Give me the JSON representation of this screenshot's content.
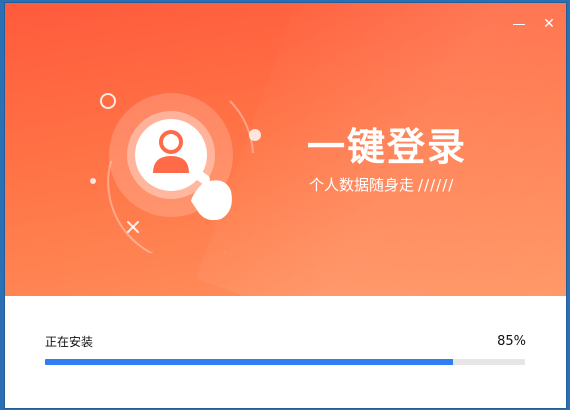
{
  "window": {
    "controls": {
      "minimize_icon": "minimize-icon",
      "close_icon": "close-icon",
      "close_glyph": "✕"
    }
  },
  "banner": {
    "title": "一键登录",
    "subtitle": "个人数据随身走",
    "slashes": "//////",
    "colors": {
      "gradient_start": "#ff5a3c",
      "gradient_end": "#ff935f"
    },
    "illustration_icons": [
      "user-avatar-icon",
      "pointing-hand-icon",
      "ring-icon",
      "dot-icon",
      "cross-icon"
    ]
  },
  "install": {
    "status_text": "正在安装",
    "percent_text": "85%",
    "progress": 85,
    "colors": {
      "bar": "#2f7ff2",
      "track": "#e6e6e6"
    }
  }
}
